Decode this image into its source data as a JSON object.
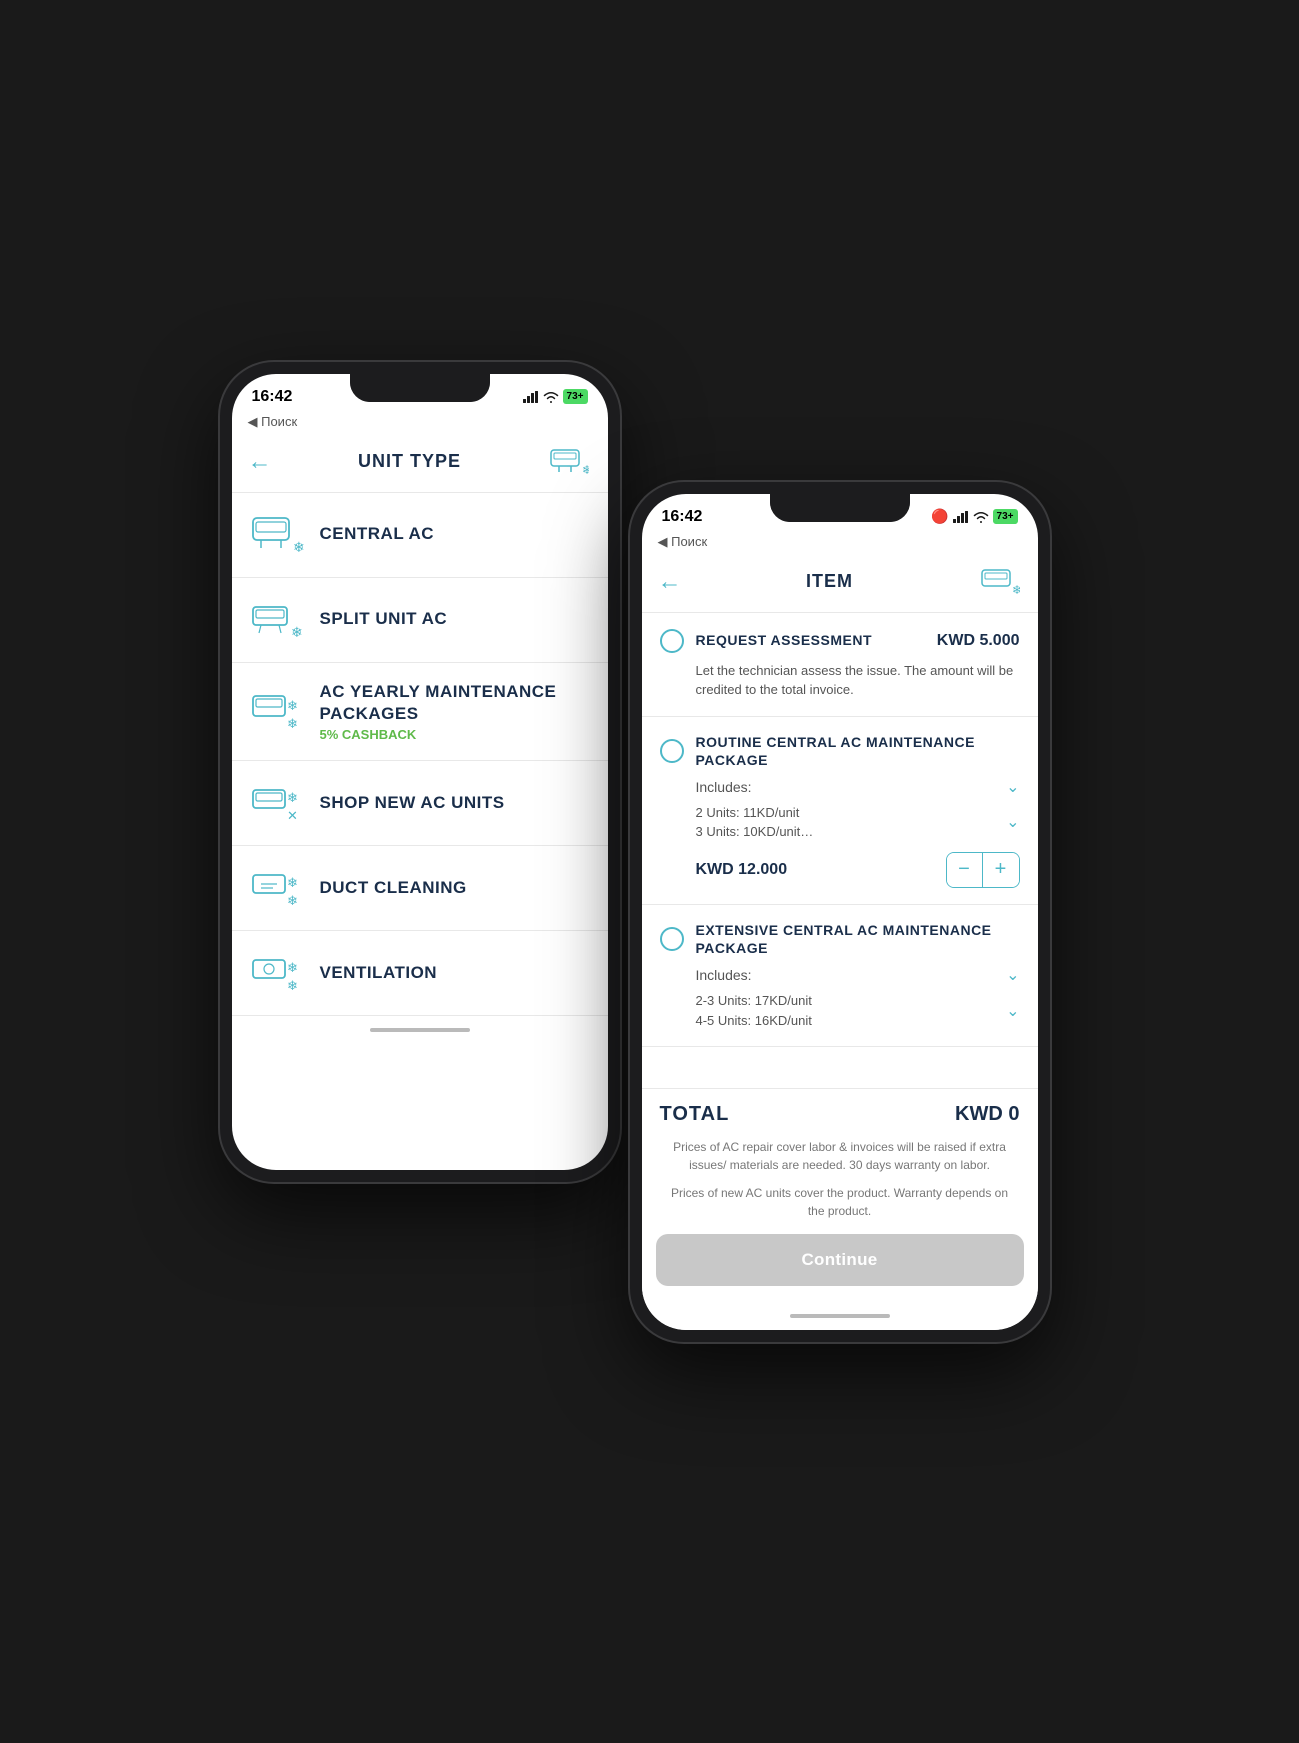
{
  "phone1": {
    "statusBar": {
      "time": "16:42",
      "back": "◀ Поиск",
      "signal": "||||",
      "wifi": "WiFi",
      "battery": "73+"
    },
    "nav": {
      "title": "UNIT TYPE",
      "backArrow": "←"
    },
    "items": [
      {
        "id": "central-ac",
        "title": "CENTRAL AC",
        "subtitle": ""
      },
      {
        "id": "split-unit-ac",
        "title": "SPLIT UNIT AC",
        "subtitle": ""
      },
      {
        "id": "ac-yearly",
        "title": "AC YEARLY MAINTENANCE PACKAGES",
        "subtitle": "5% CASHBACK"
      },
      {
        "id": "shop-new",
        "title": "SHOP NEW AC UNITS",
        "subtitle": ""
      },
      {
        "id": "duct-cleaning",
        "title": "DUCT CLEANING",
        "subtitle": ""
      },
      {
        "id": "ventilation",
        "title": "VENTILATION",
        "subtitle": ""
      }
    ]
  },
  "phone2": {
    "statusBar": {
      "time": "16:42",
      "back": "◀ Поиск",
      "signal": "||||",
      "wifi": "WiFi",
      "battery": "73+"
    },
    "nav": {
      "title": "ITEM",
      "backArrow": "←"
    },
    "items": [
      {
        "id": "request-assessment",
        "name": "REQUEST ASSESSMENT",
        "price": "KWD 5.000",
        "desc": "Let the technician assess the issue. The amount will be credited to the total invoice.",
        "hasIncludes": false,
        "hasUnits": false,
        "hasQty": false
      },
      {
        "id": "routine-central",
        "name": "ROUTINE CENTRAL AC MAINTENANCE PACKAGE",
        "price": "",
        "desc": "",
        "hasIncludes": true,
        "includesLabel": "Includes:",
        "hasUnits": true,
        "unitsText": "2 Units: 11KD/unit\n3 Units: 10KD/unit…",
        "itemPrice": "KWD 12.000",
        "hasQty": true
      },
      {
        "id": "extensive-central",
        "name": "EXTENSIVE CENTRAL AC MAINTENANCE PACKAGE",
        "price": "",
        "desc": "",
        "hasIncludes": true,
        "includesLabel": "Includes:",
        "hasUnits": true,
        "unitsText": "2-3 Units: 17KD/unit\n4-5 Units: 16KD/unit",
        "itemPrice": "",
        "hasQty": false
      }
    ],
    "footer": {
      "totalLabel": "TOTAL",
      "totalValue": "KWD 0",
      "disclaimer1": "Prices of AC repair cover labor & invoices will be raised if extra issues/ materials are needed. 30 days warranty on labor.",
      "disclaimer2": "Prices of new AC units cover the product. Warranty depends on the product.",
      "continueBtn": "Continue"
    }
  }
}
